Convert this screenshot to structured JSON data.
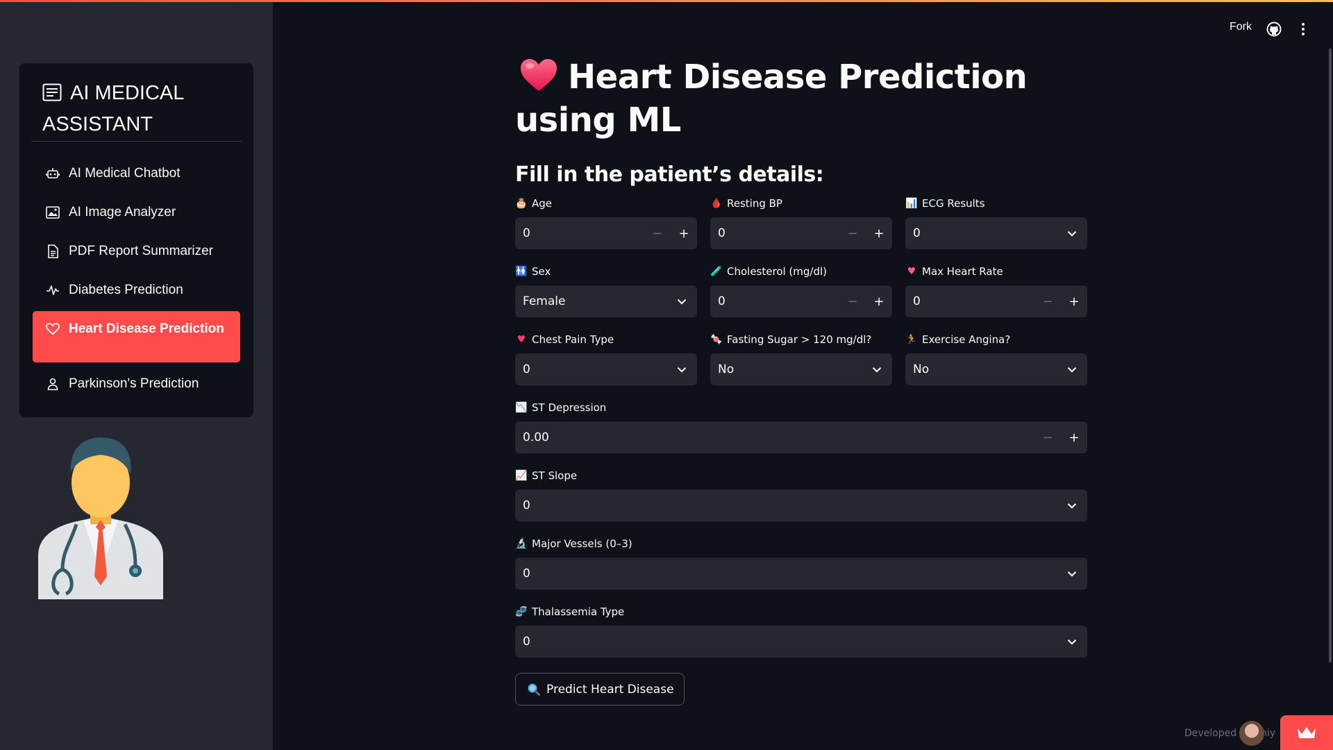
{
  "sidebar": {
    "title": "AI MEDICAL ASSISTANT",
    "items": [
      {
        "label": "AI Medical Chatbot",
        "icon": "robot-icon"
      },
      {
        "label": "AI Image Analyzer",
        "icon": "image-icon"
      },
      {
        "label": "PDF Report Summarizer",
        "icon": "document-icon"
      },
      {
        "label": "Diabetes Prediction",
        "icon": "pulse-icon"
      },
      {
        "label": "Heart Disease Prediction",
        "icon": "heart-icon",
        "active": true
      },
      {
        "label": "Parkinson's Prediction",
        "icon": "person-icon"
      }
    ],
    "accent_color": "#ff4b4b"
  },
  "header": {
    "fork_label": "Fork"
  },
  "main": {
    "title": "Heart Disease Prediction using ML",
    "subtitle": "Fill in the patient’s details:",
    "fields": {
      "age": {
        "label": "Age",
        "value": "0",
        "icon": "cake-icon",
        "type": "number"
      },
      "resting_bp": {
        "label": "Resting BP",
        "value": "0",
        "icon": "blood-drop-icon",
        "type": "number"
      },
      "ecg": {
        "label": "ECG Results",
        "value": "0",
        "icon": "bar-chart-icon",
        "type": "select"
      },
      "sex": {
        "label": "Sex",
        "value": "Female",
        "icon": "restroom-icon",
        "type": "select"
      },
      "cholesterol": {
        "label": "Cholesterol (mg/dl)",
        "value": "0",
        "icon": "test-tube-icon",
        "type": "number"
      },
      "max_hr": {
        "label": "Max Heart Rate",
        "value": "0",
        "icon": "heart-icon",
        "type": "number"
      },
      "chest_pain": {
        "label": "Chest Pain Type",
        "value": "0",
        "icon": "heartbeat-icon",
        "type": "select"
      },
      "fasting_sugar": {
        "label": "Fasting Sugar > 120 mg/dl?",
        "value": "No",
        "icon": "candy-icon",
        "type": "select"
      },
      "exercise_angina": {
        "label": "Exercise Angina?",
        "value": "No",
        "icon": "runner-icon",
        "type": "select"
      },
      "st_depression": {
        "label": "ST Depression",
        "value": "0.00",
        "icon": "chart-down-icon",
        "type": "number"
      },
      "st_slope": {
        "label": "ST Slope",
        "value": "0",
        "icon": "chart-up-icon",
        "type": "select"
      },
      "major_vessels": {
        "label": "Major Vessels (0–3)",
        "value": "0",
        "icon": "microscope-icon",
        "type": "select"
      },
      "thalassemia": {
        "label": "Thalassemia Type",
        "value": "0",
        "icon": "dna-icon",
        "type": "select"
      }
    },
    "predict_button": "Predict Heart Disease"
  },
  "footer": {
    "text": "Developed by Shiy"
  }
}
